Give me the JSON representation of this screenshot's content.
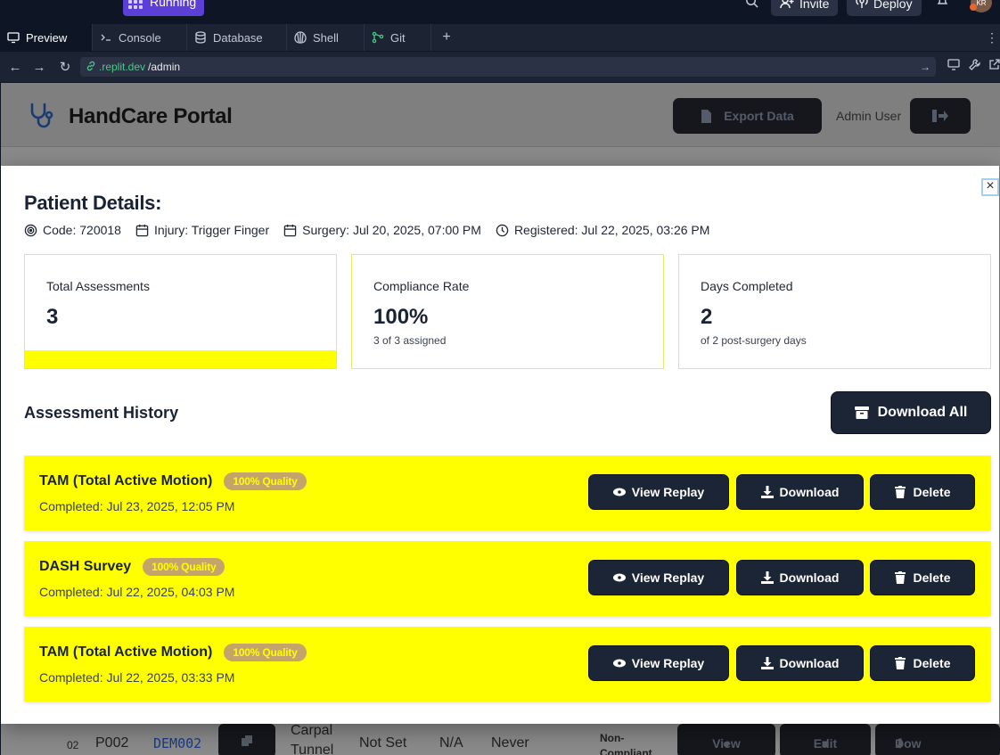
{
  "replit": {
    "status": "Running",
    "invite_label": "Invite",
    "deploy_label": "Deploy",
    "avatar_initials": "KR",
    "tabs": [
      {
        "label": "Preview",
        "icon": "monitor-icon"
      },
      {
        "label": "Console",
        "icon": "terminal-icon"
      },
      {
        "label": "Database",
        "icon": "database-icon"
      },
      {
        "label": "Shell",
        "icon": "shell-icon"
      },
      {
        "label": "Git",
        "icon": "git-icon"
      }
    ],
    "url_domain": ".replit.dev",
    "url_path": "/admin"
  },
  "app": {
    "brand": "HandCare Portal",
    "export_label": "Export Data",
    "admin_user": "Admin User",
    "background_row": {
      "num": "02",
      "id": "P002",
      "code": "DEM002",
      "injury_line1": "Carpal",
      "injury_line2": "Tunnel",
      "surgery": "Not Set",
      "rate": "N/A",
      "last": "Never",
      "status_line1": "Non-",
      "status_line2": "Compliant",
      "view_label": "View",
      "edit_label": "Edit",
      "download_label": "Dow"
    }
  },
  "modal": {
    "title": "Patient Details:",
    "meta": {
      "code": "Code: 720018",
      "injury": "Injury: Trigger Finger",
      "surgery": "Surgery: Jul 20, 2025, 07:00 PM",
      "registered": "Registered: Jul 22, 2025, 03:26 PM"
    },
    "cards": [
      {
        "label": "Total Assessments",
        "value": "3",
        "sub": ""
      },
      {
        "label": "Compliance Rate",
        "value": "100%",
        "sub": "3 of 3 assigned"
      },
      {
        "label": "Days Completed",
        "value": "2",
        "sub": "of 2 post-surgery days"
      }
    ],
    "section_title": "Assessment History",
    "download_all_label": "Download All",
    "assessments": [
      {
        "name": "TAM (Total Active Motion)",
        "quality": "100% Quality",
        "completed": "Completed: Jul 23, 2025, 12:05 PM"
      },
      {
        "name": "DASH Survey",
        "quality": "100% Quality",
        "completed": "Completed: Jul 22, 2025, 04:03 PM"
      },
      {
        "name": "TAM (Total Active Motion)",
        "quality": "100% Quality",
        "completed": "Completed: Jul 22, 2025, 03:33 PM"
      }
    ],
    "buttons": {
      "view_replay": "View Replay",
      "download": "Download",
      "delete": "Delete"
    }
  },
  "colors": {
    "highlight": "#ffff00",
    "button_dark": "#1c2536",
    "badge": "#c4a46a"
  }
}
